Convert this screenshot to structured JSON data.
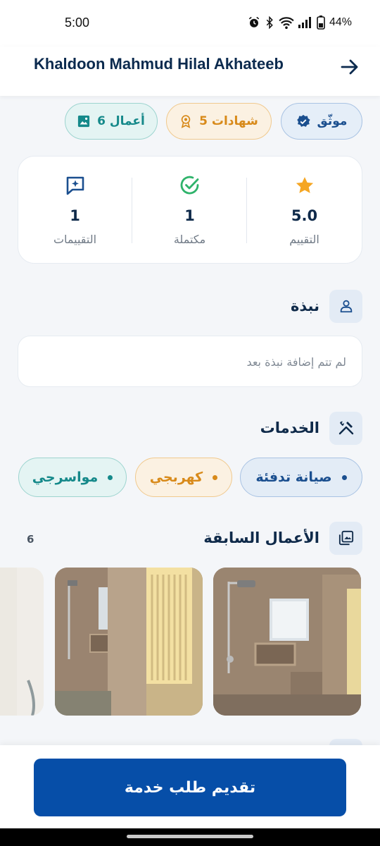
{
  "status_bar": {
    "time": "5:00",
    "battery": "44%"
  },
  "header": {
    "title": "Khaldoon Mahmud Hilal Akhateeb",
    "back_icon": "arrow-right-icon"
  },
  "badges": {
    "verified": "موثّق",
    "certificates": "5 شهادات",
    "works": "6 أعمال"
  },
  "stats": [
    {
      "label": "التقييم",
      "value": "5.0",
      "icon": "star-icon",
      "color": "#f5a623"
    },
    {
      "label": "مكتملة",
      "value": "1",
      "icon": "check-circle-icon",
      "color": "#2fb36b"
    },
    {
      "label": "التقييمات",
      "value": "1",
      "icon": "review-icon",
      "color": "#1b4f8f"
    }
  ],
  "bio": {
    "title": "نبذة",
    "text": "لم تتم إضافة نبذة بعد"
  },
  "services": {
    "title": "الخدمات",
    "items": [
      "صيانة تدفئة",
      "كهربجي",
      "مواسرجي"
    ]
  },
  "works": {
    "title": "الأعمال السابقة",
    "count": "6"
  },
  "cta": {
    "label": "تقديم طلب خدمة"
  },
  "colors": {
    "primary": "#064ea8",
    "navy": "#0f2a4a",
    "amber": "#d88a1a",
    "teal": "#15898a"
  }
}
